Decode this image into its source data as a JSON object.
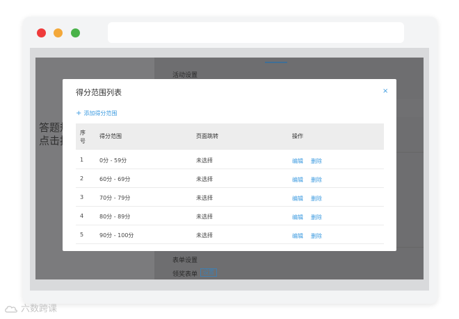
{
  "background": {
    "section_activity": "活动设置",
    "big_text_line1": "答题规",
    "big_text_line2": "点击按",
    "section_form": "表单设置",
    "prize_form_label": "领奖表单",
    "setup_button": "设置"
  },
  "modal": {
    "title": "得分范围列表",
    "close_symbol": "×",
    "add_link_plus": "+",
    "add_link_label": "添加得分范围",
    "columns": {
      "index": "序号",
      "range": "得分范围",
      "jump": "页面跳转",
      "action": "操作"
    },
    "rows": [
      {
        "index": "1",
        "range": "0分 - 59分",
        "jump": "未选择",
        "edit": "编辑",
        "delete": "删除"
      },
      {
        "index": "2",
        "range": "60分 - 69分",
        "jump": "未选择",
        "edit": "编辑",
        "delete": "删除"
      },
      {
        "index": "3",
        "range": "70分 - 79分",
        "jump": "未选择",
        "edit": "编辑",
        "delete": "删除"
      },
      {
        "index": "4",
        "range": "80分 - 89分",
        "jump": "未选择",
        "edit": "编辑",
        "delete": "删除"
      },
      {
        "index": "5",
        "range": "90分 - 100分",
        "jump": "未选择",
        "edit": "编辑",
        "delete": "删除"
      }
    ]
  },
  "watermark": {
    "text": "六数跨课",
    "logo_icon": "cloud-logo-icon"
  },
  "colors": {
    "accent": "#3d9be0",
    "overlay": "#7b7b7d",
    "close_red": "#ef3b3b",
    "minimize_yellow": "#f3a83a",
    "maximize_green": "#49b249"
  }
}
